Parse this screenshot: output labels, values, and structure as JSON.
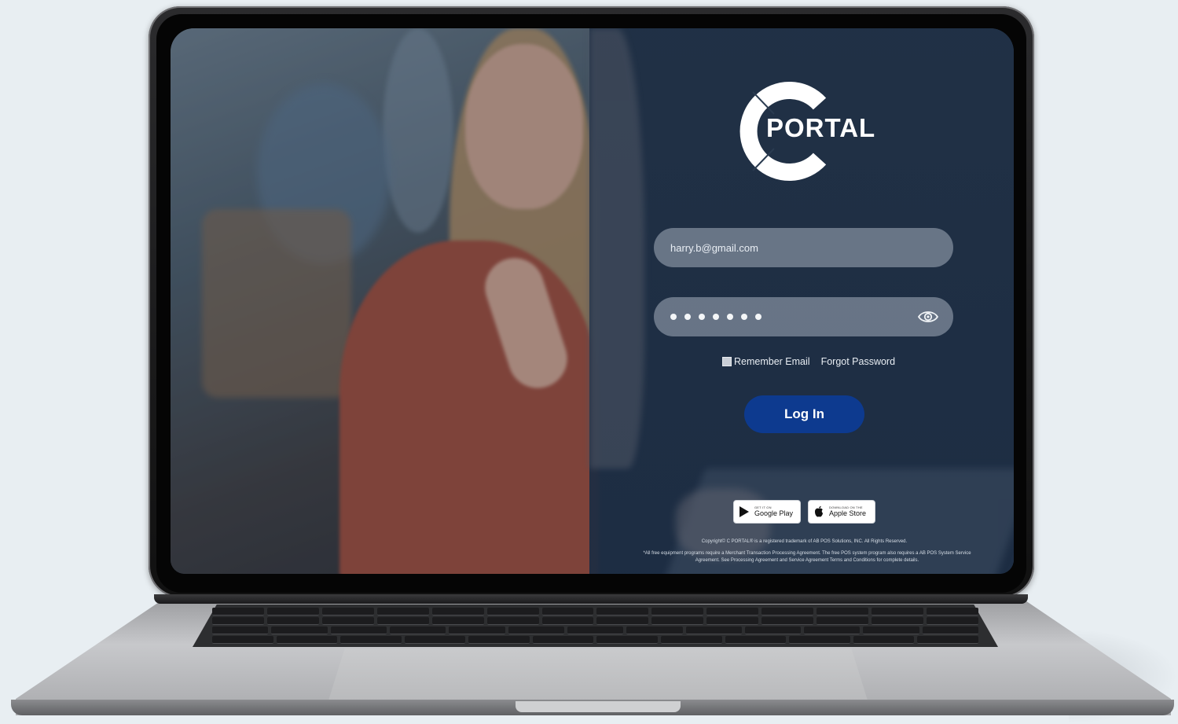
{
  "app": {
    "logo_text": "PORTAL"
  },
  "login": {
    "email_value": "harry.b@gmail.com",
    "password_dots": "•••••••",
    "remember_label": "Remember Email",
    "forgot_label": "Forgot Password",
    "login_label": "Log In"
  },
  "stores": {
    "google": {
      "small": "GET IT ON",
      "big": "Google Play"
    },
    "apple": {
      "small": "DOWNLOAD ON THE",
      "big": "Apple Store"
    }
  },
  "footer": {
    "copyright": "Copyright© C PORTAL®  is a registered trademark of AB POS Solutions, INC. All Rights Reserved.",
    "disclaimer": "*All free equipment programs require a Merchant Transaction Processing Agreement. The free POS system program also requires a AB POS System Service Agreement. See Processing Agreement and Service Agreement Terms and Conditions for complete details."
  },
  "colors": {
    "login_button": "#0d3a8f",
    "overlay": "#1f3048",
    "background": "#e8eef2"
  },
  "icons": [
    "c-portal-logo",
    "eye-icon",
    "google-play-icon",
    "apple-icon"
  ]
}
